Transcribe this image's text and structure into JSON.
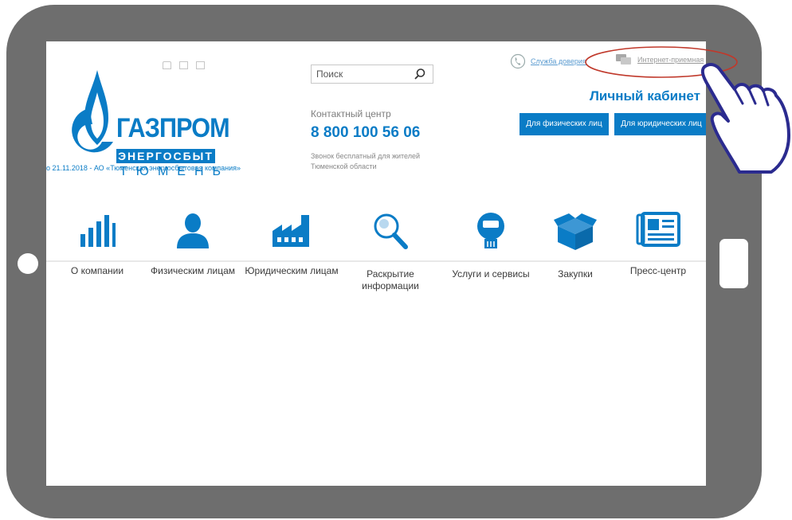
{
  "header": {
    "util_icons": [
      "home-icon",
      "sitemap-icon",
      "mail-icon"
    ],
    "logo": {
      "main": "ГАЗПРОМ",
      "sub": "ЭНЕРГОСБЫТ",
      "city": "ТЮМЕНЬ"
    },
    "tagline": "о 21.11.2018 - АО «Тюменская энергосбытовая компания»",
    "search": {
      "placeholder": "Поиск"
    },
    "contact": {
      "label": "Контактный центр",
      "phone": "8 800 100 56 06",
      "note": "Звонок бесплатный для жителей Тюменской области"
    },
    "links": {
      "trust": "Служба доверия",
      "shop": "Интернет-приемная"
    },
    "account": {
      "title": "Личный кабинет",
      "individuals_button": "Для физических лиц",
      "legal_button": "Для юридических лиц"
    }
  },
  "nav": [
    {
      "label": "О компании",
      "icon": "bar-chart-icon"
    },
    {
      "label": "Физическим лицам",
      "icon": "person-icon"
    },
    {
      "label": "Юридическим лицам",
      "icon": "factory-icon"
    },
    {
      "label": "Раскрытие информации",
      "icon": "magnifier-icon"
    },
    {
      "label": "Услуги и сервисы",
      "icon": "meter-icon"
    },
    {
      "label": "Закупки",
      "icon": "box-icon"
    },
    {
      "label": "Пресс-центр",
      "icon": "newspaper-icon"
    }
  ],
  "colors": {
    "brand": "#0a7cc6",
    "tablet_frame": "#6e6e6e",
    "highlight": "#c0392b",
    "hand_outline": "#2b2b8f"
  }
}
